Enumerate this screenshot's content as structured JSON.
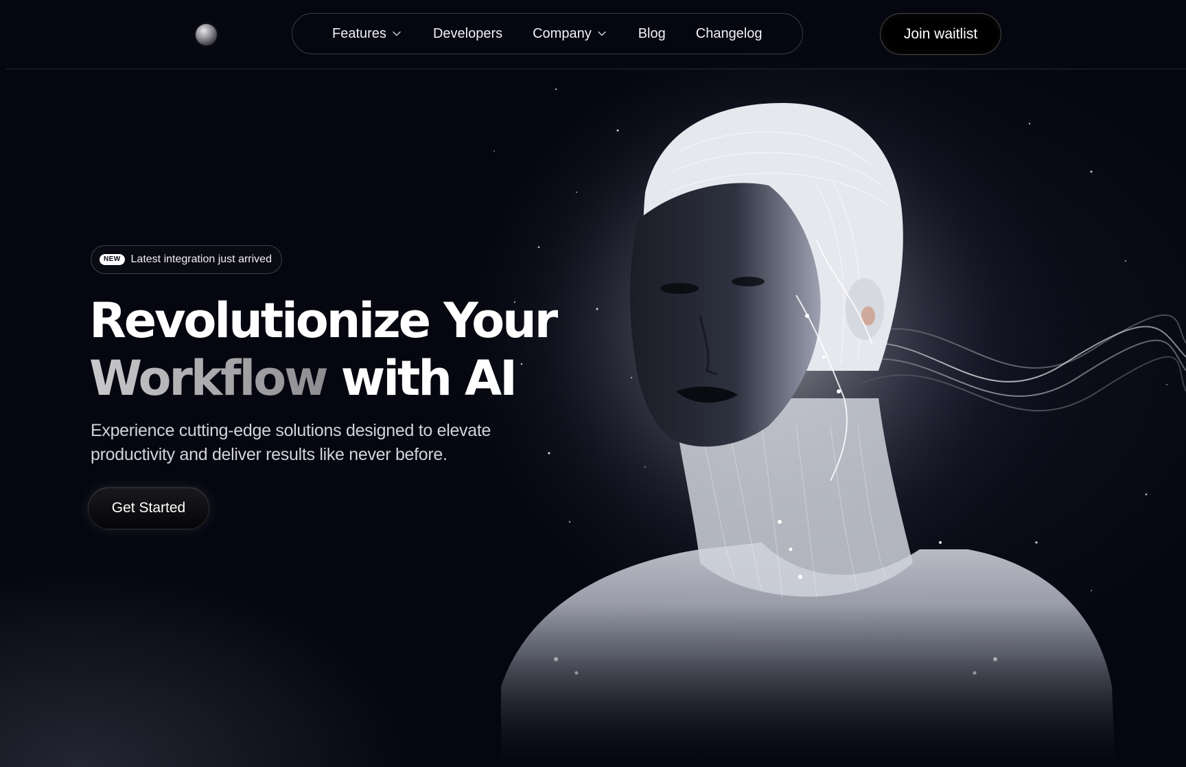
{
  "nav": {
    "items": [
      {
        "label": "Features",
        "has_dropdown": true
      },
      {
        "label": "Developers",
        "has_dropdown": false
      },
      {
        "label": "Company",
        "has_dropdown": true
      },
      {
        "label": "Blog",
        "has_dropdown": false
      },
      {
        "label": "Changelog",
        "has_dropdown": false
      }
    ],
    "join_label": "Join waitlist",
    "dropdown_icon": "chevron-down-icon",
    "logo_icon": "sphere-logo-icon"
  },
  "hero": {
    "badge": {
      "tag": "NEW",
      "text": "Latest integration just arrived"
    },
    "headline": {
      "line1": "Revolutionize Your",
      "line2_gradient": "Workflow",
      "line2_rest": "with AI"
    },
    "subheadline": "Experience cutting-edge solutions designed to elevate productivity and deliver results like never before.",
    "cta_label": "Get Started",
    "image_subject": "glowing-ai-humanoid-illustration"
  },
  "colors": {
    "background": "#05060f",
    "text": "#ffffff",
    "subtext": "#d3d3da",
    "gradient_text": "#a8a8ab"
  }
}
